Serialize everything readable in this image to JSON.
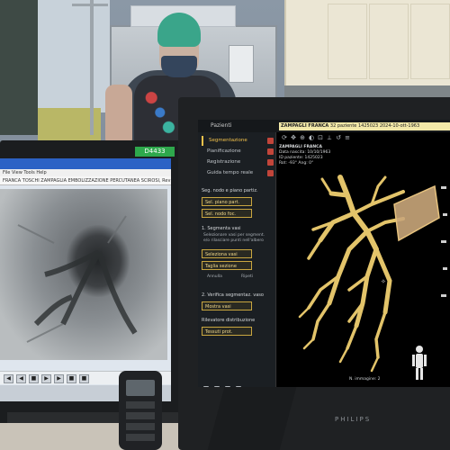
{
  "scene": {
    "description_type": "photo",
    "colors": {
      "lung_tree": "#e8c86a",
      "vessel_segment": "#c9a67a",
      "active_accent": "#f3c24b",
      "label_green": "#2ea84c"
    }
  },
  "left_monitor": {
    "sticker": "D4433",
    "window_title": "",
    "menu": "File  View  Tools  Help",
    "path": "FRANCA TOSCHI ZAMPAGLIA EMBOLIZZAZIONE PERCUTANEA SCIROSI, Rev 2",
    "controls": [
      "◀",
      "◀",
      "■",
      "▶",
      "▶",
      "■",
      "■"
    ]
  },
  "right_monitor": {
    "brand": "PHILIPS",
    "app_tab": "Pazienti",
    "patient_bar": {
      "name": "ZAMPAGLI FRANCA",
      "details": "32 paziente  1425023   2024-10-ott-1963"
    },
    "workflow_steps": [
      {
        "label": "Segmentazione",
        "active": true
      },
      {
        "label": "Pianificazione",
        "active": false
      },
      {
        "label": "Registrazione",
        "active": false
      },
      {
        "label": "Guida tempo reale",
        "active": false
      }
    ],
    "sections": [
      {
        "title": "Seg. nodo e piano partiz.",
        "button": "Sel. piano part.",
        "button2": "Sel. nodo foc."
      },
      {
        "title": "1. Segmenta vasi",
        "text": "Selezionare vasi per segment. e/o rilasciare punti nell'albero",
        "button": "Seleziona vasi",
        "button2": "Taglia sezione"
      },
      {
        "title": "2. Verifica segmentaz. vaso",
        "button": "Mostra vasi"
      },
      {
        "title": "Rilevatore distribuzione",
        "button": "Tessuti prot."
      }
    ],
    "action_labels": [
      "Annulla",
      "Ripeti"
    ],
    "image_info": {
      "line1": "ZAMPAGLI FRANCA",
      "line2": "Data nascita: 10/10/1963",
      "line3": "ID paziente: 1425023",
      "line4": "Rot: -93° Ang: 0°"
    },
    "view_label": "N. immagine: 2"
  }
}
